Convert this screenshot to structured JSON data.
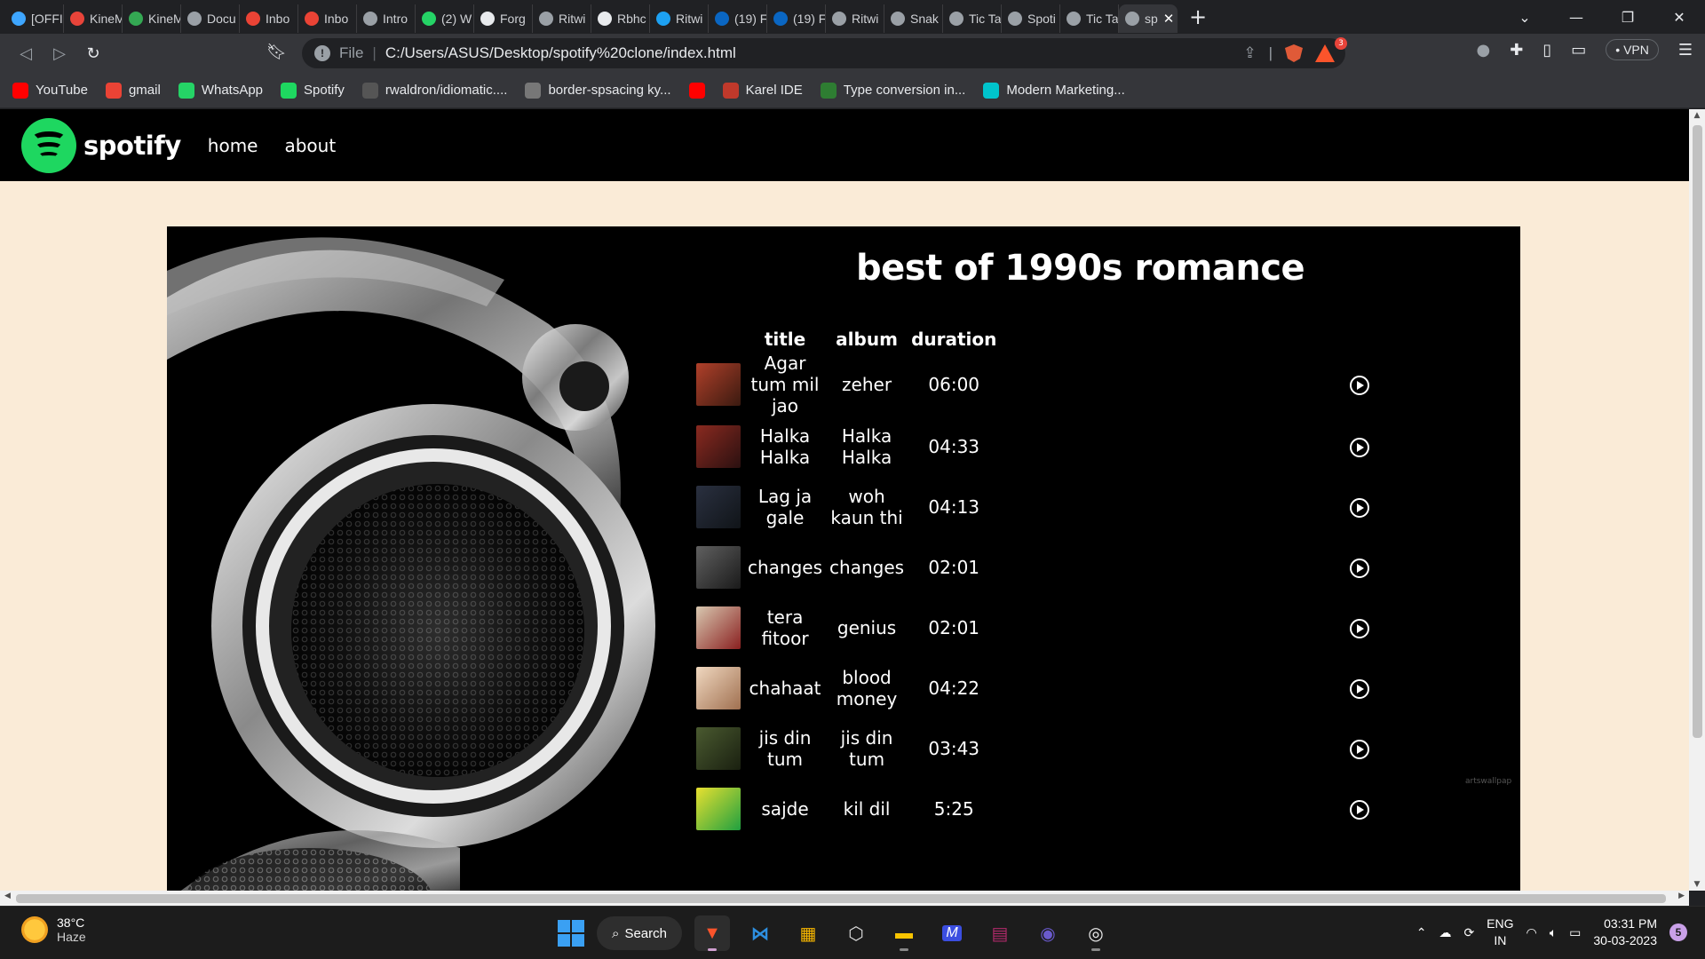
{
  "browser": {
    "tabs": [
      {
        "label": "[OFFI",
        "icon": "youtube-studio-icon",
        "color": "#3ea6ff"
      },
      {
        "label": "KineM",
        "icon": "kinemaster-icon",
        "color": "#e8443a"
      },
      {
        "label": "KineM",
        "icon": "play-store-icon",
        "color": "#34a853"
      },
      {
        "label": "Docu",
        "icon": "globe-icon",
        "color": "#9aa0a6"
      },
      {
        "label": "Inbo",
        "icon": "gmail-icon",
        "color": "#ea4335"
      },
      {
        "label": "Inbo",
        "icon": "gmail-icon",
        "color": "#ea4335"
      },
      {
        "label": "Intro",
        "icon": "openai-icon",
        "color": "#9aa0a6"
      },
      {
        "label": "(2) W",
        "icon": "whatsapp-icon",
        "color": "#25d366"
      },
      {
        "label": "Forg",
        "icon": "github-icon",
        "color": "#e8eaed"
      },
      {
        "label": "Ritwi",
        "icon": "globe-icon",
        "color": "#9aa0a6"
      },
      {
        "label": "Rbhc",
        "icon": "github-icon",
        "color": "#e8eaed"
      },
      {
        "label": "Ritwi",
        "icon": "twitter-icon",
        "color": "#1da1f2"
      },
      {
        "label": "(19) F",
        "icon": "linkedin-icon",
        "color": "#0a66c2"
      },
      {
        "label": "(19) F",
        "icon": "linkedin-icon",
        "color": "#0a66c2"
      },
      {
        "label": "Ritwi",
        "icon": "globe-icon",
        "color": "#9aa0a6"
      },
      {
        "label": "Snak",
        "icon": "globe-icon",
        "color": "#9aa0a6"
      },
      {
        "label": "Tic Ta",
        "icon": "globe-icon",
        "color": "#9aa0a6"
      },
      {
        "label": "Spoti",
        "icon": "globe-icon",
        "color": "#9aa0a6"
      },
      {
        "label": "Tic Ta",
        "icon": "globe-icon",
        "color": "#9aa0a6"
      },
      {
        "label": "sp",
        "icon": "globe-icon",
        "color": "#9aa0a6",
        "active": true
      }
    ],
    "address": {
      "scheme_label": "File",
      "url": "C:/Users/ASUS/Desktop/spotify%20clone/index.html"
    },
    "rewards_count": "3",
    "vpn_label": "VPN",
    "bookmarks": [
      {
        "label": "YouTube",
        "icon": "youtube-icon",
        "color": "#ff0000"
      },
      {
        "label": "gmail",
        "icon": "gmail-icon",
        "color": "#ea4335"
      },
      {
        "label": "WhatsApp",
        "icon": "whatsapp-icon",
        "color": "#25d366"
      },
      {
        "label": "Spotify",
        "icon": "spotify-icon",
        "color": "#1ed760"
      },
      {
        "label": "rwaldron/idiomatic....",
        "icon": "github-icon",
        "color": "#555555"
      },
      {
        "label": "border-spsacing ky...",
        "icon": "globe-icon",
        "color": "#777777"
      },
      {
        "label": "",
        "icon": "youtube-icon",
        "color": "#ff0000"
      },
      {
        "label": "Karel IDE",
        "icon": "karel-icon",
        "color": "#c0392b"
      },
      {
        "label": "Type conversion in...",
        "icon": "code-icon",
        "color": "#2e7d32"
      },
      {
        "label": "Modern Marketing...",
        "icon": "canva-icon",
        "color": "#00c4cc"
      }
    ]
  },
  "site": {
    "brand": "spotify",
    "nav": {
      "home": "home",
      "about": "about"
    },
    "playlist_title": "best of 1990s romance",
    "watermark": "artswallpap",
    "columns": {
      "title": "title",
      "album": "album",
      "duration": "duration"
    },
    "songs": [
      {
        "title": "Agar tum mil jao",
        "album": "zeher",
        "duration": "06:00",
        "thumb": [
          "#b0402a",
          "#3a1a10"
        ]
      },
      {
        "title": "Halka Halka",
        "album": "Halka Halka",
        "duration": "04:33",
        "thumb": [
          "#8a2a20",
          "#2a1010"
        ]
      },
      {
        "title": "Lag ja gale",
        "album": "woh kaun thi",
        "duration": "04:13",
        "thumb": [
          "#2a3040",
          "#101418"
        ]
      },
      {
        "title": "changes",
        "album": "changes",
        "duration": "02:01",
        "thumb": [
          "#606060",
          "#1a1a1a"
        ]
      },
      {
        "title": "tera fitoor",
        "album": "genius",
        "duration": "02:01",
        "thumb": [
          "#d8c8b0",
          "#8a2020"
        ]
      },
      {
        "title": "chahaat",
        "album": "blood money",
        "duration": "04:22",
        "thumb": [
          "#f0d8c0",
          "#a07050"
        ]
      },
      {
        "title": "jis din tum",
        "album": "jis din tum",
        "duration": "03:43",
        "thumb": [
          "#4a5a30",
          "#1a2010"
        ]
      },
      {
        "title": "sajde",
        "album": "kil dil",
        "duration": "5:25",
        "thumb": [
          "#e8e030",
          "#20a040"
        ]
      }
    ],
    "colors": {
      "background": "#faebd7",
      "nav": "#000000",
      "accent": "#1ed760"
    }
  },
  "taskbar": {
    "temperature": "38°C",
    "condition": "Haze",
    "search_label": "Search",
    "lang_top": "ENG",
    "lang_bottom": "IN",
    "time": "03:31 PM",
    "date": "30-03-2023",
    "notifications": "5"
  }
}
